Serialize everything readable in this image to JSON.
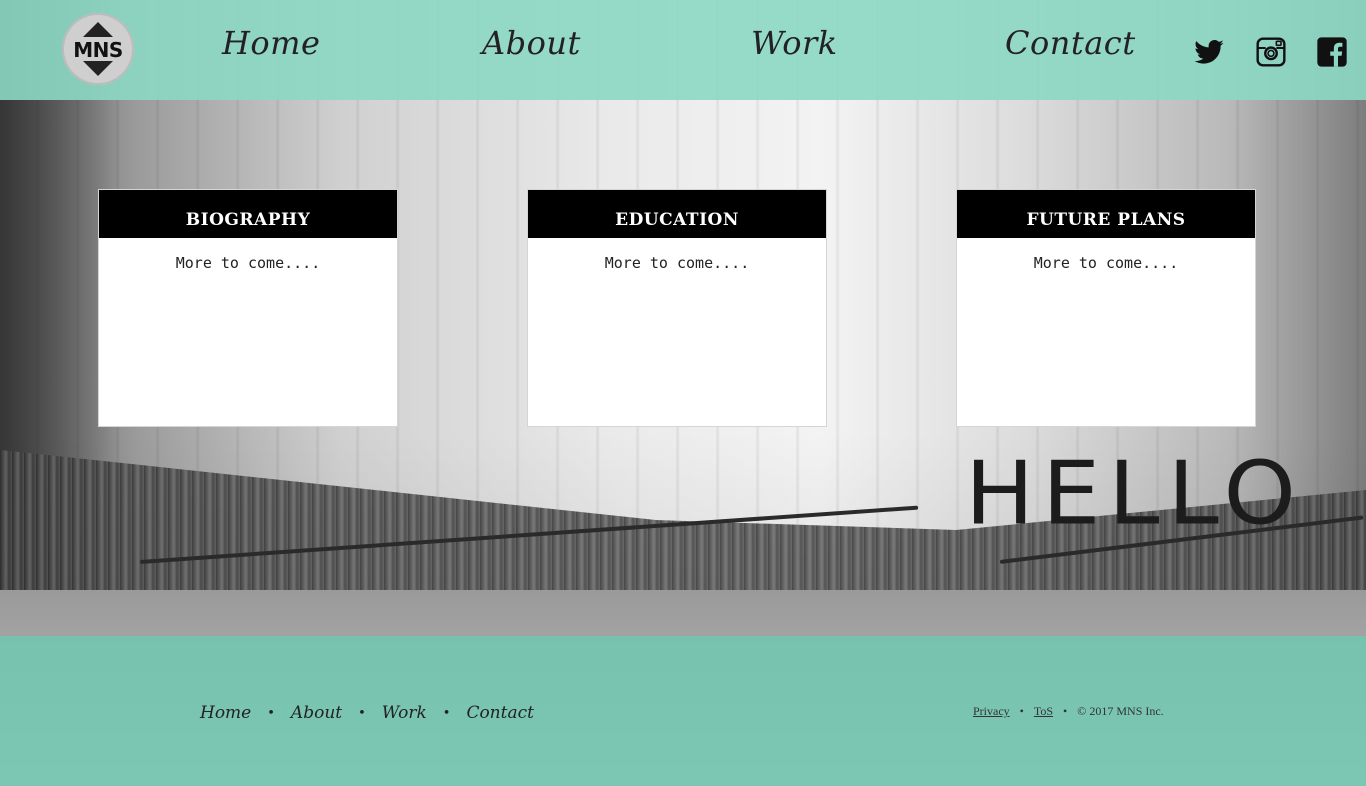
{
  "brand": {
    "logo_text": "MNS"
  },
  "nav": {
    "items": [
      {
        "label": "Home"
      },
      {
        "label": "About"
      },
      {
        "label": "Work"
      },
      {
        "label": "Contact"
      }
    ]
  },
  "social": [
    {
      "icon": "twitter-icon"
    },
    {
      "icon": "instagram-icon"
    },
    {
      "icon": "facebook-icon"
    }
  ],
  "background": {
    "wall_text": "HELLO"
  },
  "cards": [
    {
      "title": "BIOGRAPHY",
      "body": "More to come...."
    },
    {
      "title": "EDUCATION",
      "body": "More to come...."
    },
    {
      "title": "FUTURE PLANS",
      "body": "More to come...."
    }
  ],
  "footer": {
    "nav": [
      {
        "label": "Home"
      },
      {
        "label": "About"
      },
      {
        "label": "Work"
      },
      {
        "label": "Contact"
      }
    ],
    "separator": "•",
    "privacy_label": "Privacy",
    "tos_label": "ToS",
    "copyright": "© 2017 MNS Inc."
  },
  "colors": {
    "header_bg": "#8cd7c3",
    "footer_bg": "#6ec8b2",
    "card_header_bg": "#000000"
  }
}
